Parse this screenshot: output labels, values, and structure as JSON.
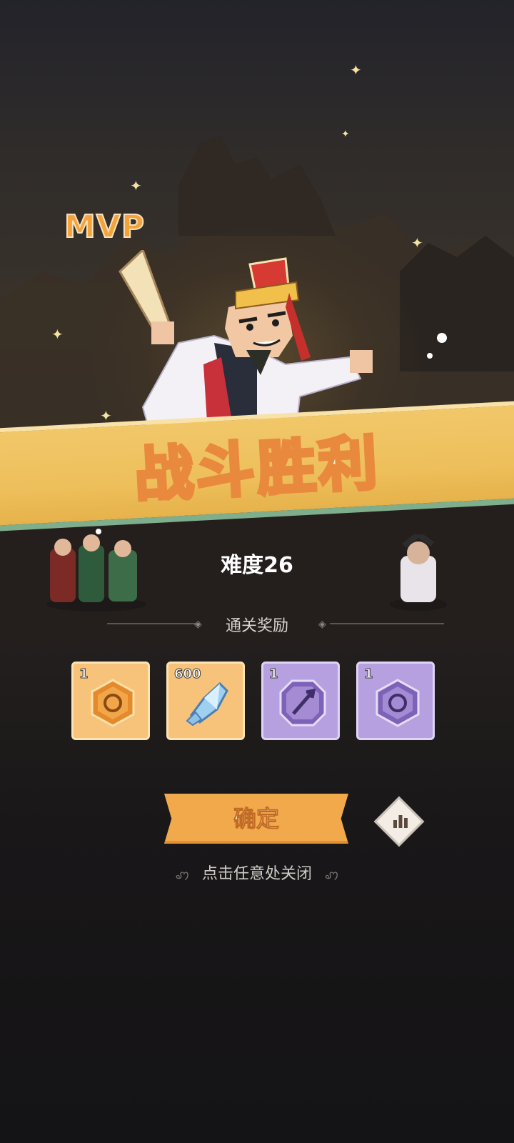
{
  "mvp_label": "MVP",
  "banner_title": "战斗胜利",
  "difficulty": "难度26",
  "rewards_header": "通关奖励",
  "rewards": [
    {
      "count": "1",
      "icon": "gold-hexagon-swirl-icon",
      "tier": "gold"
    },
    {
      "count": "600",
      "icon": "blue-crystal-icon",
      "tier": "gold"
    },
    {
      "count": "1",
      "icon": "purple-sword-badge-icon",
      "tier": "purple"
    },
    {
      "count": "1",
      "icon": "purple-hexagon-swirl-icon",
      "tier": "purple"
    }
  ],
  "confirm_button": "确定",
  "stats_button_icon": "bar-chart-icon",
  "close_hint": "点击任意处关闭",
  "colors": {
    "banner": "#eec05c",
    "banner_text_stroke": "#e9893d",
    "gold_card": "#f7c37a",
    "purple_card": "#b7a0e0",
    "confirm_button": "#f2a94b"
  }
}
